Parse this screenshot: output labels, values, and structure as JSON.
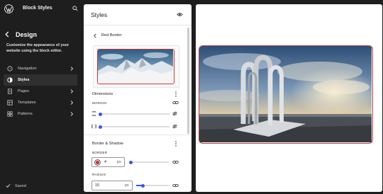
{
  "app": {
    "site_title": "Block Styles"
  },
  "sidebar": {
    "title": "Design",
    "description": "Customize the appearance of your website using the block editor.",
    "items": [
      {
        "label": "Navigation",
        "icon": "navigation-icon"
      },
      {
        "label": "Styles",
        "icon": "styles-icon",
        "active": true
      },
      {
        "label": "Pages",
        "icon": "page-icon"
      },
      {
        "label": "Templates",
        "icon": "layout-icon"
      },
      {
        "label": "Patterns",
        "icon": "symbol-icon"
      }
    ],
    "status": "Saved"
  },
  "styles_panel": {
    "title": "Styles",
    "subpage_title": "Red Border",
    "dimensions": {
      "title": "Dimensions",
      "margin_label": "MARGIN"
    },
    "border_shadow": {
      "title": "Border & Shadow",
      "border_label": "BORDER",
      "border_width": "4",
      "border_unit": "px",
      "border_color": "#cc3333",
      "radius_label": "RADIUS",
      "radius_value": "15",
      "radius_unit": "px"
    }
  },
  "colors": {
    "accent": "#3858e9",
    "border_red": "#b94048",
    "sidebar_bg": "#1e1e1e"
  }
}
